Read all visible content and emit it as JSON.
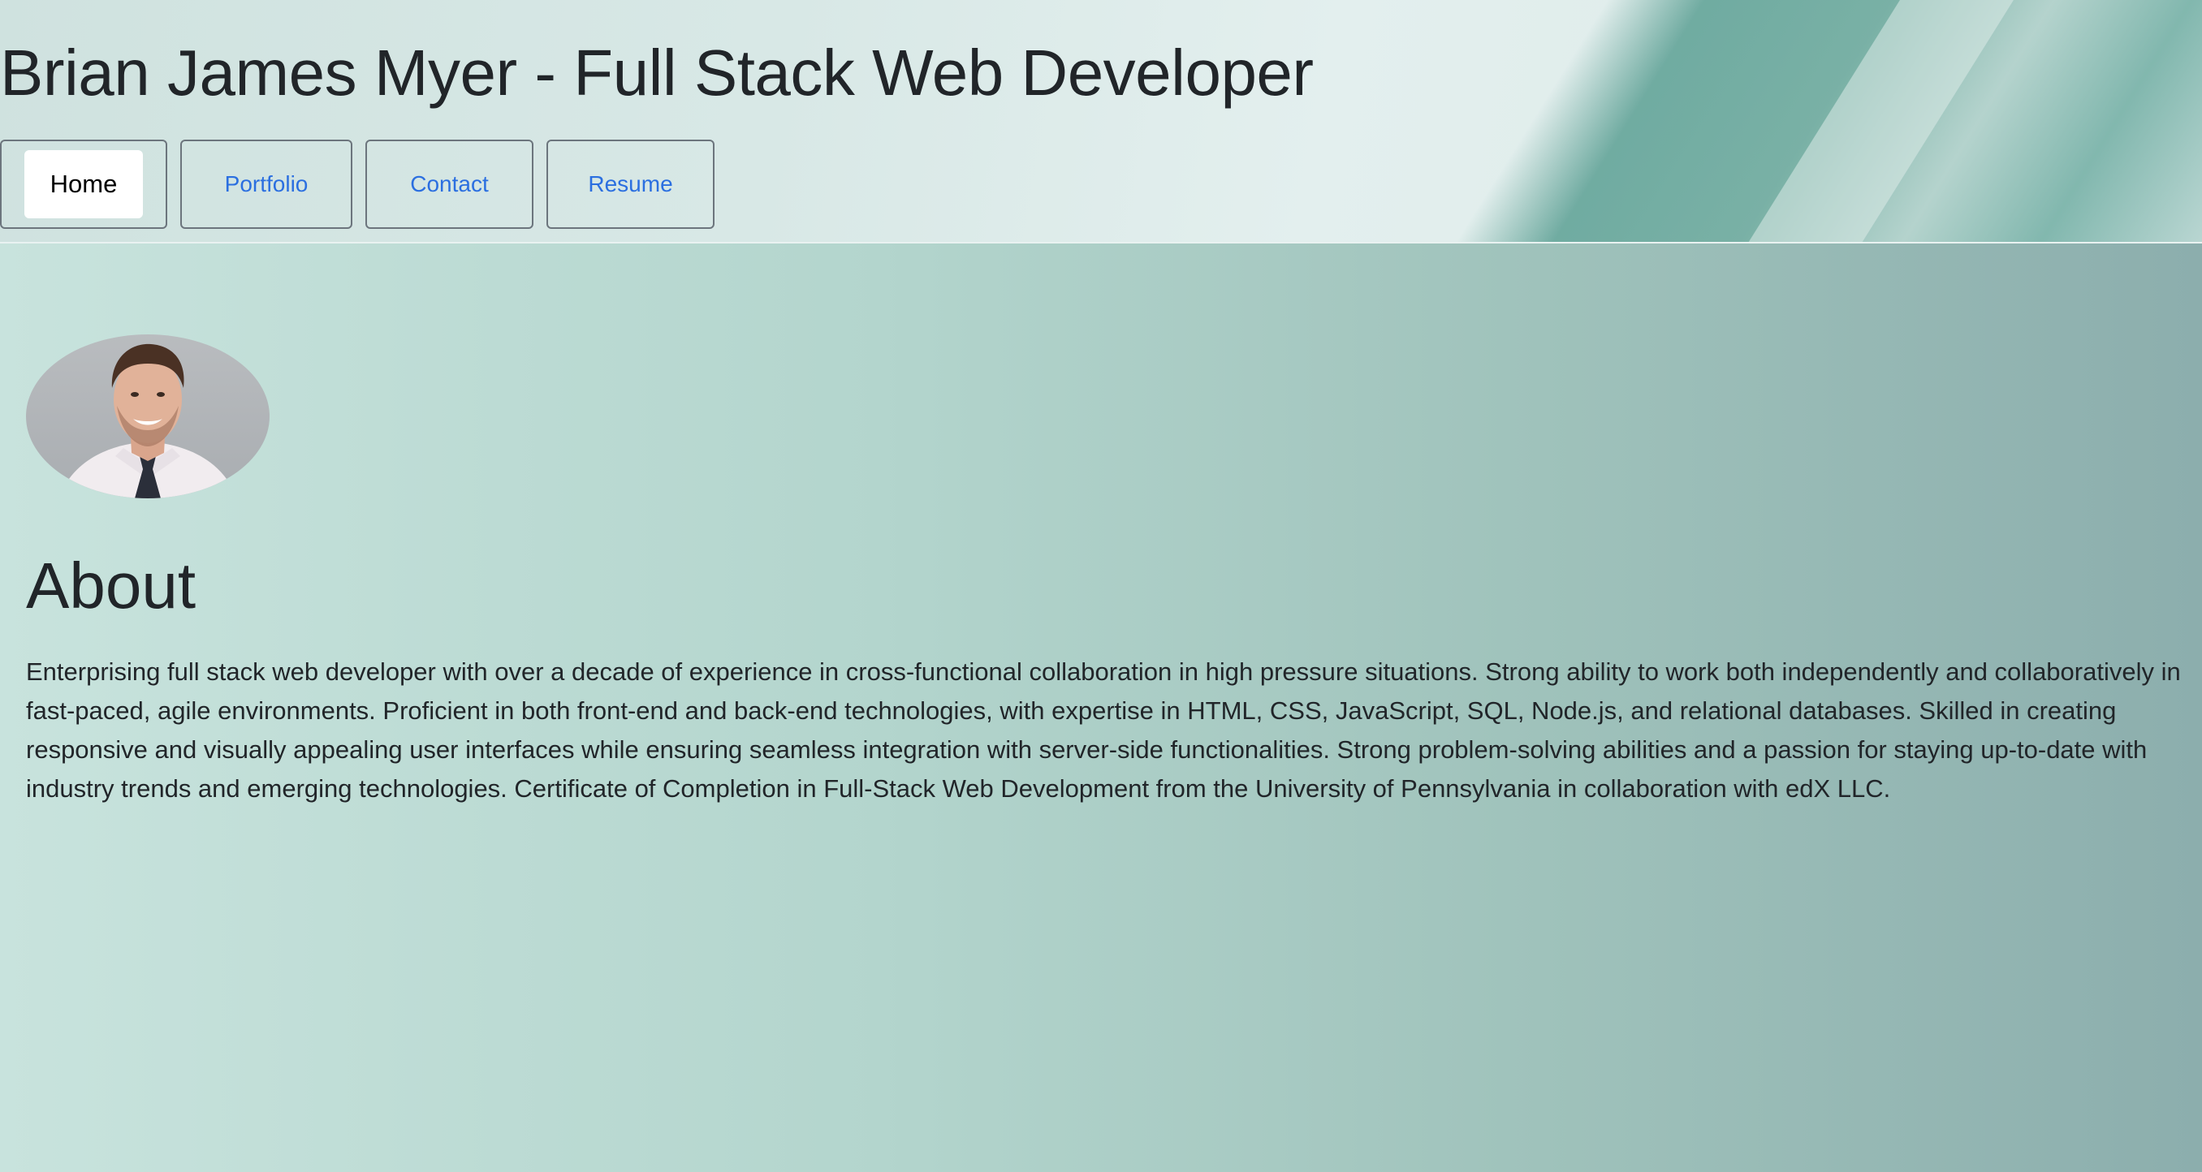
{
  "header": {
    "title": "Brian James Myer - Full Stack Web Developer"
  },
  "nav": {
    "home": "Home",
    "portfolio": "Portfolio",
    "contact": "Contact",
    "resume": "Resume",
    "active": "Home"
  },
  "about": {
    "heading": "About",
    "body": "Enterprising full stack web developer with over a decade of experience in cross-functional collaboration in high pressure situations. Strong ability to work both independently and collaboratively in fast-paced, agile environments. Proficient in both front-end and back-end technologies, with expertise in HTML, CSS, JavaScript, SQL, Node.js, and relational databases. Skilled in creating responsive and visually appealing user interfaces while ensuring seamless integration with server-side functionalities. Strong problem-solving abilities and a passion for staying up-to-date with industry trends and emerging technologies. Certificate of Completion in Full-Stack Web Development from the University of Pennsylvania in collaboration with edX LLC."
  },
  "colors": {
    "link": "#2b6fe0",
    "text": "#212529",
    "tab_border": "#6c757d",
    "accent_teal": "#5ca094"
  }
}
